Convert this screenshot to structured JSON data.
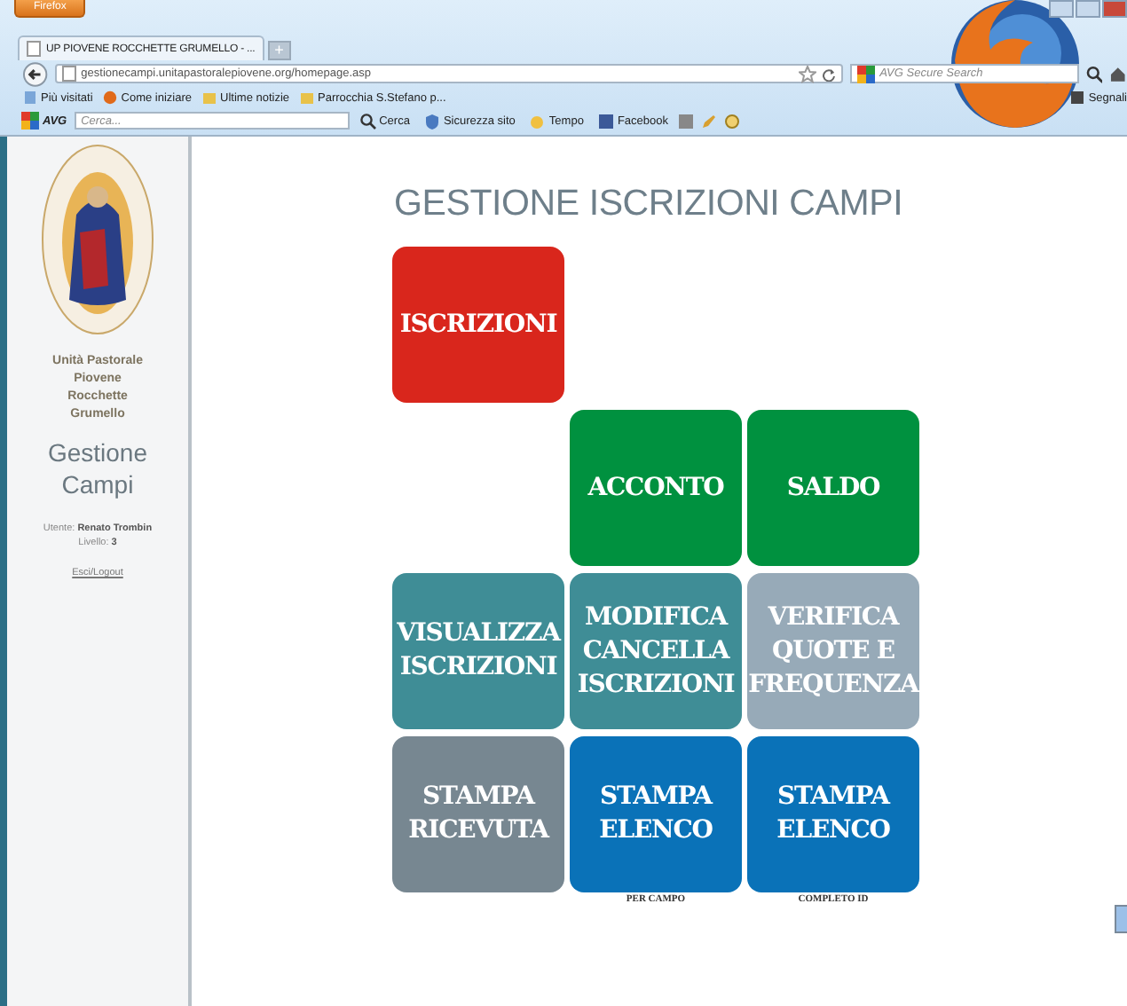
{
  "browser": {
    "menu_button": "Firefox",
    "tabs": [
      {
        "title": "UP PIOVENE ROCCHETTE GRUMELLO - ...",
        "selected": true
      }
    ],
    "new_tab": "+",
    "address": "gestionecampi.unitapastoralepiovene.org/homepage.asp",
    "search": {
      "placeholder": "AVG Secure Search"
    },
    "bookmarks": [
      "Più visitati",
      "Come iniziare",
      "Ultime notizie",
      "Parrocchia S.Stefano p..."
    ],
    "bookmarks_right": "Segnali",
    "avg_toolbar": {
      "brand": "AVG",
      "search": {
        "placeholder": "Cerca..."
      },
      "search_button": "Cerca",
      "items": [
        "Sicurezza sito",
        "Tempo",
        "Facebook"
      ]
    }
  },
  "sidebar": {
    "org_lines": [
      "Unità Pastorale",
      "Piovene",
      "Rocchette",
      "Grumello"
    ],
    "app_title": [
      "Gestione",
      "Campi"
    ],
    "user": "Utente: **Renato Trombin**",
    "level": "Livello: **3**",
    "logout": "Esci/Logout"
  },
  "main": {
    "title": "GESTIONE ISCRIZIONI CAMPI",
    "tile_rows": [
      [
        {
          "kind": "tile",
          "lines": [
            "ISCRIZIONI"
          ],
          "color": "#d9261c"
        },
        {
          "kind": "blank"
        },
        {
          "kind": "blank"
        }
      ],
      [
        {
          "kind": "blank"
        },
        {
          "kind": "tile",
          "lines": [
            "ACCONTO"
          ],
          "color": "#00913f"
        },
        {
          "kind": "tile",
          "lines": [
            "SALDO"
          ],
          "color": "#00913f"
        }
      ],
      [
        {
          "kind": "tile",
          "lines": [
            "VISUALIZZA",
            "ISCRIZIONI"
          ],
          "color": "#3f8d96"
        },
        {
          "kind": "tile",
          "lines": [
            "MODIFICA",
            "CANCELLA",
            "ISCRIZIONI"
          ],
          "color": "#3f8d96"
        },
        {
          "kind": "tile",
          "lines": [
            "VERIFICA",
            "QUOTE E",
            "FREQUENZA"
          ],
          "color": "#97aab8"
        }
      ],
      [
        {
          "kind": "tile",
          "lines": [
            "STAMPA",
            "RICEVUTA"
          ],
          "color": "#778791"
        },
        {
          "kind": "tile",
          "lines": [
            "STAMPA",
            "ELENCO"
          ],
          "color": "#0a72b8",
          "caption": "PER CAMPO"
        },
        {
          "kind": "tile",
          "lines": [
            "STAMPA",
            "ELENCO"
          ],
          "color": "#0a72b8",
          "caption": "COMPLETO ID"
        }
      ]
    ]
  }
}
